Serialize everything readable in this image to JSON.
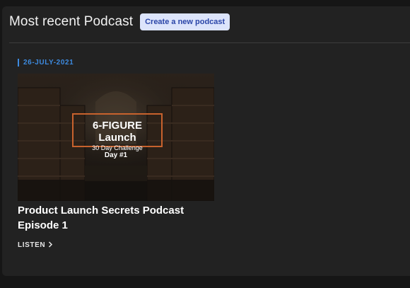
{
  "header": {
    "title": "Most recent Podcast",
    "create_button": "Create a new podcast"
  },
  "episode": {
    "date": "26-JULY-2021",
    "thumbnail": {
      "title": "6-FIGURE Launch",
      "subtitle": "30 Day Challenge",
      "day": "Day #1"
    },
    "title": "Product Launch Secrets Podcast Episode 1",
    "listen_label": "LISTEN"
  },
  "colors": {
    "background": "#161616",
    "panel": "#222222",
    "accent_blue": "#3d8be0",
    "button_bg": "#dce4fb",
    "button_text": "#2b46a8",
    "thumb_border": "#c8622d"
  },
  "icons": {
    "listen_chevron": "chevron-right-icon"
  }
}
